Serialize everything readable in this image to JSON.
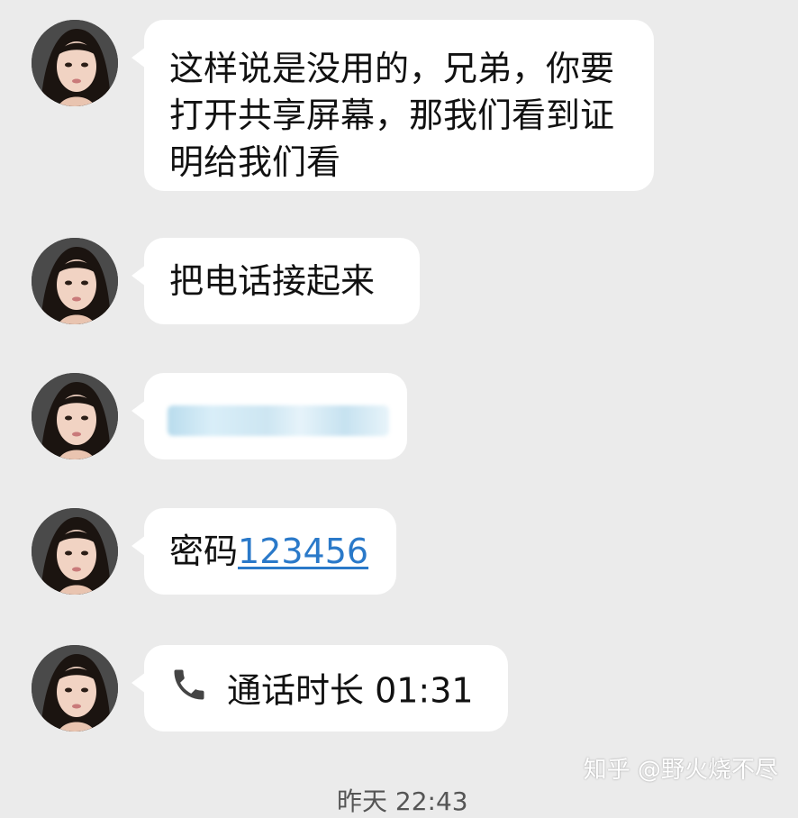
{
  "messages": [
    {
      "text": "这样说是没用的，兄弟，你要打开共享屏幕，那我们看到证明给我们看"
    },
    {
      "text": "把电话接起来"
    },
    {
      "text": ""
    },
    {
      "prefix": "密码",
      "link": "123456"
    },
    {
      "call_label": "通话时长 01:31",
      "icon": "phone-icon"
    }
  ],
  "timestamp": "昨天 22:43",
  "watermark": "知乎 @野火烧不尽",
  "colors": {
    "background": "#ebebeb",
    "bubble": "#ffffff",
    "link": "#2a79c9"
  }
}
